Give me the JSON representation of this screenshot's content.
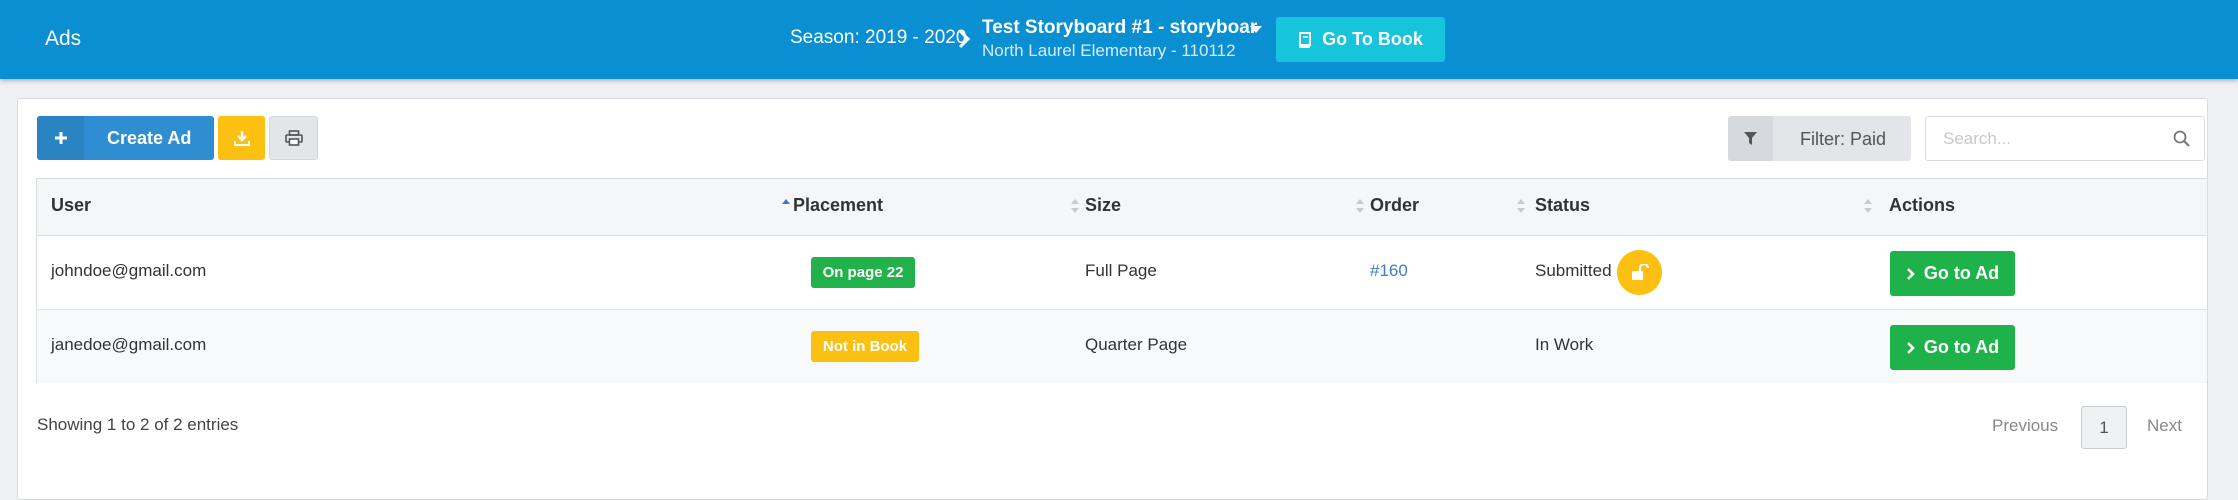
{
  "header": {
    "app_title": "Ads",
    "season": "Season: 2019 - 2020",
    "book_title": "Test Storyboard #1 - storyboar",
    "school": "North Laurel Elementary - 110112",
    "go_to_book_label": "Go To Book"
  },
  "toolbar": {
    "create_ad_label": "Create Ad",
    "filter_label": "Filter: Paid",
    "search_placeholder": "Search..."
  },
  "table": {
    "columns": [
      "User",
      "Placement",
      "Size",
      "Order",
      "Status",
      "Actions"
    ],
    "sorted_column": "User",
    "rows": [
      {
        "user": "johndoe@gmail.com",
        "placement": "On page 22",
        "placement_color": "#22b24c",
        "size": "Full Page",
        "order": "#160",
        "status": "Submitted",
        "status_icon": "unlock-icon",
        "action": "Go to Ad"
      },
      {
        "user": "janedoe@gmail.com",
        "placement": "Not in Book",
        "placement_color": "#fbc012",
        "size": "Quarter Page",
        "order": "",
        "status": "In Work",
        "action": "Go to Ad"
      }
    ]
  },
  "footer": {
    "showing": "Showing 1 to 2 of 2 entries",
    "previous": "Previous",
    "page": "1",
    "next": "Next"
  },
  "colors": {
    "header_bg": "#0b8fd3",
    "primary": "#2e8ed1",
    "warning": "#fbc012",
    "success": "#1fb24a",
    "info": "#16c4dc"
  }
}
